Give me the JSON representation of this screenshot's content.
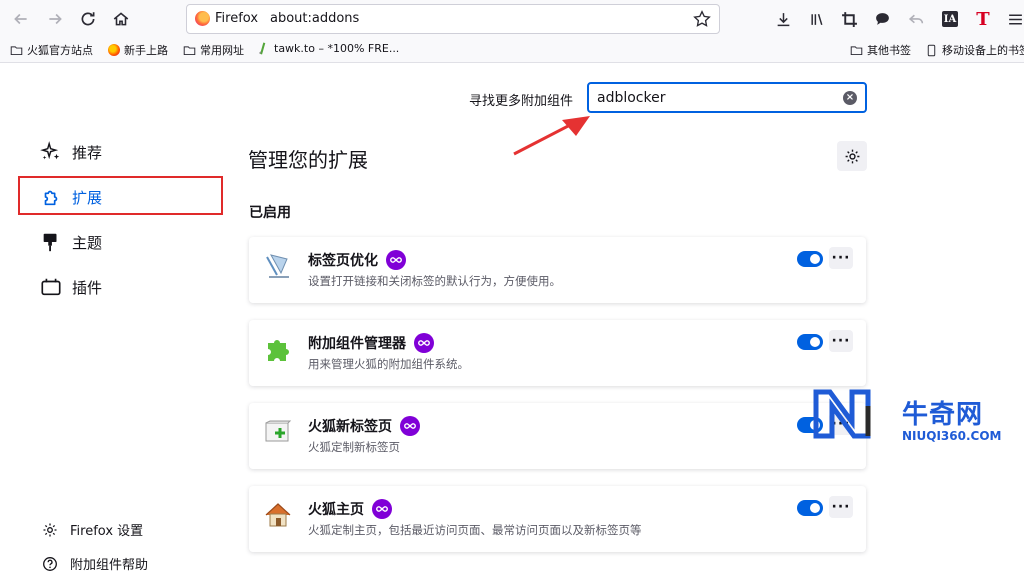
{
  "toolbar": {
    "identity_label": "Firefox",
    "url": "about:addons"
  },
  "bookmarks": [
    {
      "label": "火狐官方站点",
      "icon": "folder-icon"
    },
    {
      "label": "新手上路",
      "icon": "firefox-globe-icon"
    },
    {
      "label": "常用网址",
      "icon": "folder-icon"
    },
    {
      "label": "tawk.to – *100% FRE...",
      "icon": "tawk-icon"
    },
    {
      "label": "其他书签",
      "icon": "folder-icon"
    },
    {
      "label": "移动设备上的书签",
      "icon": "mobile-icon"
    }
  ],
  "search": {
    "label": "寻找更多附加组件",
    "value": "adblocker"
  },
  "sidebar": {
    "items": [
      {
        "label": "推荐",
        "icon": "sparkle-icon"
      },
      {
        "label": "扩展",
        "icon": "puzzle-icon",
        "active": true
      },
      {
        "label": "主题",
        "icon": "brush-icon"
      },
      {
        "label": "插件",
        "icon": "plugin-icon"
      }
    ],
    "footer": [
      {
        "label": "Firefox 设置",
        "icon": "gear-icon"
      },
      {
        "label": "附加组件帮助",
        "icon": "help-icon"
      }
    ]
  },
  "main": {
    "title": "管理您的扩展",
    "section": "已启用",
    "extensions": [
      {
        "name": "标签页优化",
        "desc": "设置打开链接和关闭标签的默认行为，方便使用。"
      },
      {
        "name": "附加组件管理器",
        "desc": "用来管理火狐的附加组件系统。"
      },
      {
        "name": "火狐新标签页",
        "desc": "火狐定制新标签页"
      },
      {
        "name": "火狐主页",
        "desc": "火狐定制主页，包括最近访问页面、最常访问页面以及新标签页等"
      }
    ]
  },
  "watermark": {
    "cn": "牛奇网",
    "en": "NIUQI360.COM"
  },
  "colors": {
    "accent": "#0061e0",
    "highlight": "#e02a2a",
    "badge": "#8000d7"
  }
}
